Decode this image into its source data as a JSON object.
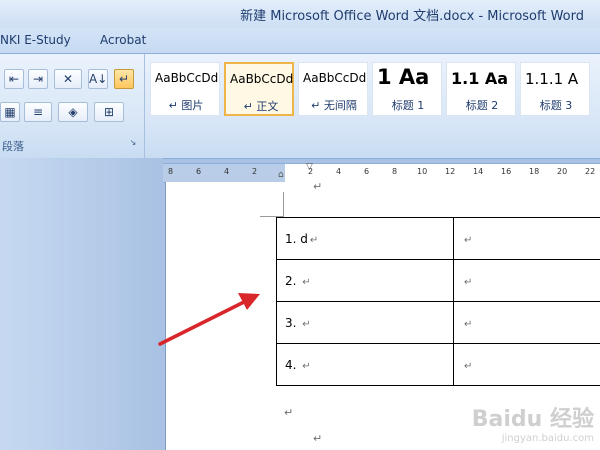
{
  "window": {
    "title": "新建 Microsoft Office Word 文档.docx - Microsoft Word"
  },
  "menu_tabs": [
    {
      "label": "NKI E-Study"
    },
    {
      "label": "Acrobat"
    }
  ],
  "paragraph_group": {
    "label": "段落",
    "launcher_glyph": "↘",
    "buttons": [
      {
        "name": "decrease-indent",
        "glyph": "⇤"
      },
      {
        "name": "increase-indent",
        "glyph": "⇥"
      },
      {
        "name": "chinese-layout",
        "glyph": "✕"
      },
      {
        "name": "sort",
        "glyph": "A↓"
      },
      {
        "name": "show-marks",
        "glyph": "↵",
        "active": true
      },
      {
        "name": "distribute",
        "glyph": "▦"
      },
      {
        "name": "line-spacing",
        "glyph": "≡"
      },
      {
        "name": "shading",
        "glyph": "◈"
      },
      {
        "name": "borders",
        "glyph": "⊞"
      }
    ]
  },
  "styles": [
    {
      "preview": "AaBbCcDd",
      "name": "↵ 图片",
      "kind": "normal"
    },
    {
      "preview": "AaBbCcDd",
      "name": "↵ 正文",
      "kind": "normal",
      "selected": true
    },
    {
      "preview": "AaBbCcDd",
      "name": "↵ 无间隔",
      "kind": "normal"
    },
    {
      "preview": "1  Aa",
      "name": "标题 1",
      "kind": "h1"
    },
    {
      "preview": "1.1  Aa",
      "name": "标题 2",
      "kind": "h2"
    },
    {
      "preview": "1.1.1  A",
      "name": "标题 3",
      "kind": "h3"
    }
  ],
  "ruler": {
    "ticks": [
      "8",
      "6",
      "4",
      "2",
      "2",
      "4",
      "6",
      "8",
      "10",
      "12",
      "14",
      "16",
      "18",
      "20",
      "22"
    ]
  },
  "document": {
    "para_mark": "↵",
    "rows": [
      {
        "number": "1. d",
        "right": ""
      },
      {
        "number": "2. ",
        "right": ""
      },
      {
        "number": "3. ",
        "right": ""
      },
      {
        "number": "4. ",
        "right": ""
      }
    ]
  },
  "watermark": {
    "main": "Baidu 经验",
    "sub": "jingyan.baidu.com"
  },
  "colors": {
    "arrow": "#d8262a",
    "selected_style_border": "#f0b54a",
    "ribbon_bg": "#d6e5f6"
  }
}
